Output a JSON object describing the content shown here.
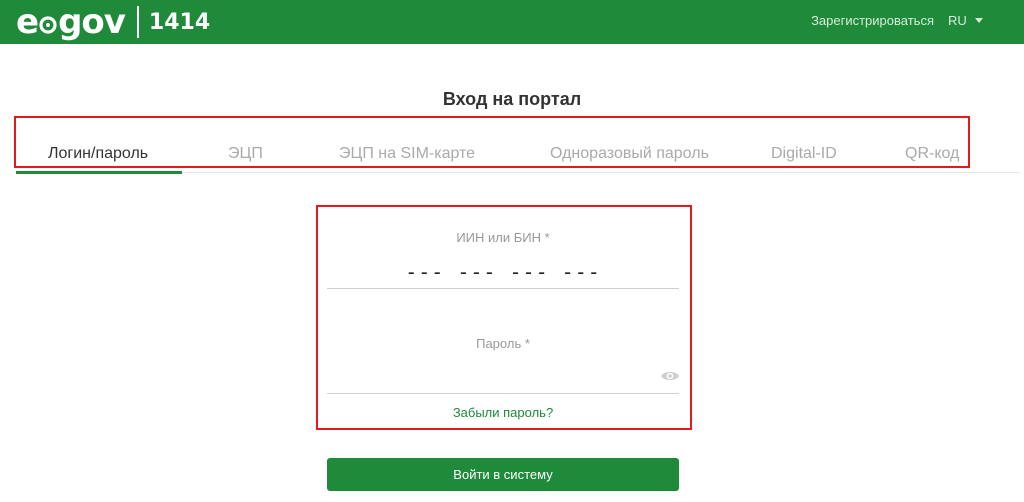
{
  "header": {
    "logo_text_1": "e",
    "logo_text_2": "gov",
    "logo_number": "1414",
    "register_label": "Зарегистрироваться",
    "language": "RU",
    "background_color": "#1e8a3a"
  },
  "page": {
    "title": "Вход на портал"
  },
  "tabs": [
    {
      "label": "Логин/пароль",
      "active": true
    },
    {
      "label": "ЭЦП",
      "active": false
    },
    {
      "label": "ЭЦП на SIM-карте",
      "active": false
    },
    {
      "label": "Одноразовый пароль",
      "active": false
    },
    {
      "label": "Digital-ID",
      "active": false
    },
    {
      "label": "QR-код",
      "active": false
    }
  ],
  "form": {
    "iin_label": "ИИН или БИН *",
    "iin_value": "",
    "iin_placeholder": "--- --- --- ---",
    "password_label": "Пароль *",
    "password_value": "",
    "password_icon": "eye-icon",
    "forgot_label": "Забыли пароль?",
    "login_label": "Войти в систему"
  },
  "colors": {
    "accent": "#1e8a3a",
    "highlight_border": "#e31b1b"
  }
}
